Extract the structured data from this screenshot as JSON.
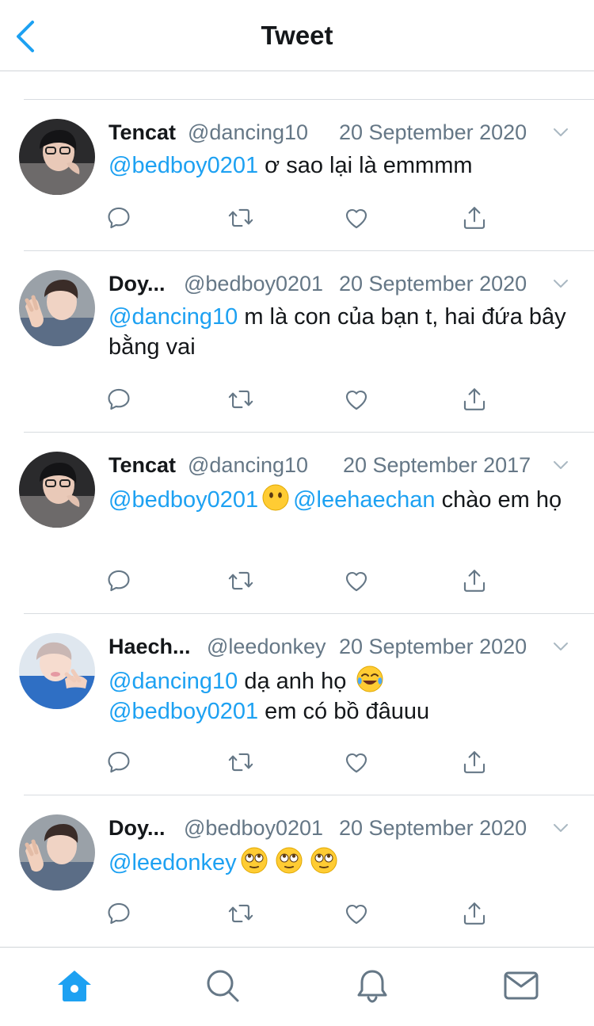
{
  "header": {
    "title": "Tweet",
    "back_icon": "chevron-left-icon"
  },
  "colors": {
    "accent": "#1da1f2",
    "text": "#14171a",
    "secondary": "#657786",
    "divider": "#d8dce0"
  },
  "tweets": [
    {
      "name": "Tencat",
      "handle": "@dancing10",
      "date": "20 September 2020",
      "body": [
        {
          "type": "mention",
          "text": "@bedboy0201"
        },
        {
          "type": "text",
          "text": " ơ sao lại là emmmm"
        }
      ]
    },
    {
      "name": "Doy...",
      "handle": "@bedboy0201",
      "date": "20 September 2020",
      "body": [
        {
          "type": "mention",
          "text": "@dancing10"
        },
        {
          "type": "text",
          "text": " m là con của bạn t, hai đứa bây bằng vai"
        }
      ]
    },
    {
      "name": "Tencat",
      "handle": "@dancing10",
      "date": "20 September 2017",
      "body": [
        {
          "type": "mention",
          "text": "@bedboy0201"
        },
        {
          "type": "emoji",
          "name": "face-without-mouth-emoji"
        },
        {
          "type": "mention",
          "text": "@leehaechan"
        },
        {
          "type": "text",
          "text": " chào em họ"
        }
      ]
    },
    {
      "name": "Haech...",
      "handle": "@leedonkey",
      "date": "20 September 2020",
      "body": [
        {
          "type": "mention",
          "text": "@dancing10"
        },
        {
          "type": "text",
          "text": " dạ anh họ "
        },
        {
          "type": "emoji",
          "name": "tears-of-joy-emoji"
        },
        {
          "type": "br"
        },
        {
          "type": "mention",
          "text": "@bedboy0201"
        },
        {
          "type": "text",
          "text": " em có bồ đâuuu"
        }
      ]
    },
    {
      "name": "Doy...",
      "handle": "@bedboy0201",
      "date": "20 September 2020",
      "body": [
        {
          "type": "mention",
          "text": "@leedonkey"
        },
        {
          "type": "emoji",
          "name": "rolling-eyes-emoji"
        },
        {
          "type": "emoji",
          "name": "rolling-eyes-emoji"
        },
        {
          "type": "emoji",
          "name": "rolling-eyes-emoji"
        }
      ]
    }
  ],
  "action_icons": [
    "reply-icon",
    "retweet-icon",
    "like-icon",
    "share-icon"
  ],
  "tabbar": [
    {
      "icon": "home-icon",
      "active": true
    },
    {
      "icon": "search-icon",
      "active": false
    },
    {
      "icon": "notifications-icon",
      "active": false
    },
    {
      "icon": "messages-icon",
      "active": false
    }
  ]
}
